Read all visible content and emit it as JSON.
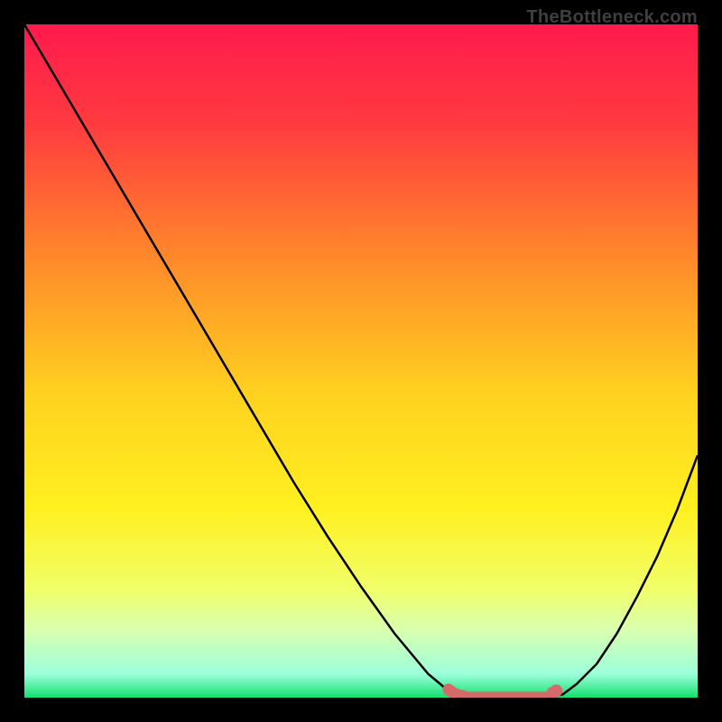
{
  "watermark": "TheBottleneck.com",
  "chart_data": {
    "type": "line",
    "title": "",
    "xlabel": "",
    "ylabel": "",
    "xlim": [
      0,
      1
    ],
    "ylim": [
      0,
      100
    ],
    "gradient_stops": [
      {
        "offset": 0.0,
        "color": "#ff1a4d"
      },
      {
        "offset": 0.15,
        "color": "#ff3b3f"
      },
      {
        "offset": 0.35,
        "color": "#ff8a2a"
      },
      {
        "offset": 0.55,
        "color": "#ffd21f"
      },
      {
        "offset": 0.72,
        "color": "#fff020"
      },
      {
        "offset": 0.84,
        "color": "#f1ff6a"
      },
      {
        "offset": 0.9,
        "color": "#d9ffb0"
      },
      {
        "offset": 0.965,
        "color": "#9cffdb"
      },
      {
        "offset": 1.0,
        "color": "#13e06e"
      }
    ],
    "series": [
      {
        "name": "bottleneck-curve",
        "x": [
          0.0,
          0.05,
          0.1,
          0.15,
          0.2,
          0.25,
          0.3,
          0.35,
          0.4,
          0.45,
          0.5,
          0.55,
          0.6,
          0.63,
          0.66,
          0.7,
          0.74,
          0.78,
          0.8,
          0.82,
          0.85,
          0.88,
          0.91,
          0.94,
          0.97,
          1.0
        ],
        "y": [
          100.0,
          91.5,
          83.0,
          74.5,
          66.0,
          57.5,
          49.0,
          40.5,
          32.0,
          24.0,
          16.5,
          9.5,
          3.5,
          1.0,
          0.0,
          0.0,
          0.0,
          0.0,
          0.5,
          2.0,
          5.0,
          9.5,
          15.0,
          21.0,
          28.0,
          36.0
        ]
      }
    ],
    "highlight": {
      "name": "min-region",
      "color": "#d66a6a",
      "x": [
        0.63,
        0.64,
        0.66,
        0.68,
        0.7,
        0.72,
        0.74,
        0.76,
        0.78,
        0.785
      ],
      "y": [
        1.2,
        0.5,
        0.0,
        0.0,
        0.0,
        0.0,
        0.0,
        0.0,
        0.0,
        0.8
      ]
    },
    "end_dot": {
      "x": 0.79,
      "y": 1.0,
      "color": "#d66a6a"
    }
  }
}
